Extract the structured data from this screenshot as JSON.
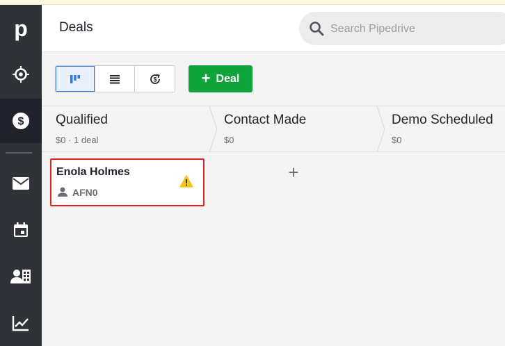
{
  "header": {
    "title": "Deals",
    "search_placeholder": "Search Pipedrive"
  },
  "sidebar": {
    "items": [
      {
        "icon": "pipedrive-logo-icon",
        "label": "p"
      },
      {
        "icon": "leads-target-icon"
      },
      {
        "icon": "deals-dollar-icon",
        "active": true
      },
      {
        "icon": "mail-icon"
      },
      {
        "icon": "calendar-icon"
      },
      {
        "icon": "contacts-icon"
      },
      {
        "icon": "insights-chart-icon"
      }
    ]
  },
  "toolbar": {
    "views": [
      {
        "icon": "pipeline-view-icon",
        "active": true
      },
      {
        "icon": "list-view-icon"
      },
      {
        "icon": "forecast-view-icon"
      }
    ],
    "add_deal_label": "Deal"
  },
  "pipeline": {
    "stages": [
      {
        "name": "Qualified",
        "meta": "$0 · 1 deal"
      },
      {
        "name": "Contact Made",
        "meta": "$0"
      },
      {
        "name": "Demo Scheduled",
        "meta": "$0"
      }
    ]
  },
  "deals": [
    {
      "title": "Enola Holmes",
      "org": "AFN0",
      "warning": true
    }
  ],
  "colors": {
    "sidebar_bg": "#2f3337",
    "sidebar_active": "#21232c",
    "add_button": "#0ea33b",
    "selected_outline": "#e02424",
    "warning": "#f5c518",
    "view_active": "#317ae2"
  }
}
